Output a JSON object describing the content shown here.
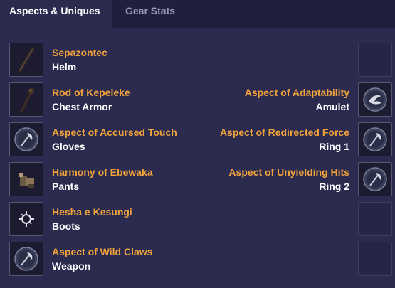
{
  "tabs": {
    "aspects": "Aspects & Uniques",
    "gear": "Gear Stats"
  },
  "left": [
    {
      "name": "Sepazontec",
      "slot": "Helm",
      "icon": "staff-icon"
    },
    {
      "name": "Rod of Kepeleke",
      "slot": "Chest Armor",
      "icon": "rod-icon"
    },
    {
      "name": "Aspect of Accursed Touch",
      "slot": "Gloves",
      "icon": "aspect-axe-icon"
    },
    {
      "name": "Harmony of Ebewaka",
      "slot": "Pants",
      "icon": "totem-icon"
    },
    {
      "name": "Hesha e Kesungi",
      "slot": "Boots",
      "icon": "sigil-icon"
    },
    {
      "name": "Aspect of Wild Claws",
      "slot": "Weapon",
      "icon": "aspect-axe-icon"
    }
  ],
  "right": [
    {
      "name": "",
      "slot": "",
      "icon": "empty-slot"
    },
    {
      "name": "Aspect of Adaptability",
      "slot": "Amulet",
      "icon": "aspect-swirl-icon"
    },
    {
      "name": "Aspect of Redirected Force",
      "slot": "Ring 1",
      "icon": "aspect-axe-icon"
    },
    {
      "name": "Aspect of Unyielding Hits",
      "slot": "Ring 2",
      "icon": "aspect-axe-icon"
    },
    {
      "name": "",
      "slot": "",
      "icon": "empty-slot"
    },
    {
      "name": "",
      "slot": "",
      "icon": "empty-slot"
    }
  ]
}
